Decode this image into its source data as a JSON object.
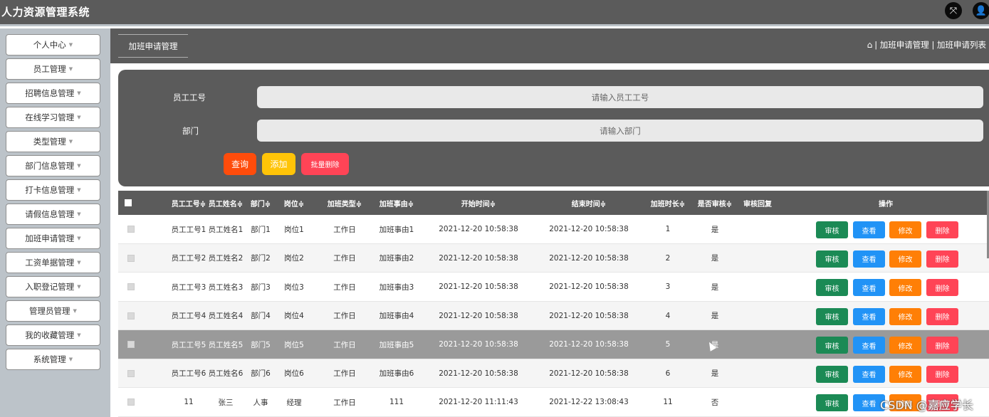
{
  "app": {
    "title": "人力资源管理系统",
    "icons": [
      "fullscreen-icon",
      "user-icon"
    ]
  },
  "sidebar": {
    "items": [
      {
        "label": "个人中心"
      },
      {
        "label": "员工管理"
      },
      {
        "label": "招聘信息管理"
      },
      {
        "label": "在线学习管理"
      },
      {
        "label": "类型管理"
      },
      {
        "label": "部门信息管理"
      },
      {
        "label": "打卡信息管理"
      },
      {
        "label": "请假信息管理"
      },
      {
        "label": "加班申请管理"
      },
      {
        "label": "工资单据管理"
      },
      {
        "label": "入职登记管理"
      },
      {
        "label": "管理员管理"
      },
      {
        "label": "我的收藏管理"
      },
      {
        "label": "系统管理"
      }
    ]
  },
  "header": {
    "tab": "加班申请管理",
    "breadcrumb": "| 加班申请管理 | 加班申请列表"
  },
  "search": {
    "employee_no_label": "员工工号",
    "employee_no_placeholder": "请输入员工工号",
    "dept_label": "部门",
    "dept_placeholder": "请输入部门",
    "query_button": "查询",
    "add_button": "添加",
    "batch_delete_button": "批量删除"
  },
  "table": {
    "columns": [
      "员工工号≑",
      "员工姓名≑",
      "部门≑",
      "岗位≑",
      "加班类型≑",
      "加班事由≑",
      "开始时间≑",
      "结束时间≑",
      "加班时长≑",
      "是否审核≑",
      "审核回复",
      "操作"
    ],
    "rows": [
      {
        "emp_no": "员工工号1",
        "name": "员工姓名1",
        "dept": "部门1",
        "post": "岗位1",
        "type": "工作日",
        "reason": "加班事由1",
        "start": "2021-12-20 10:58:38",
        "end": "2021-12-20 10:58:38",
        "hours": "1",
        "approved": "是",
        "reply": ""
      },
      {
        "emp_no": "员工工号2",
        "name": "员工姓名2",
        "dept": "部门2",
        "post": "岗位2",
        "type": "工作日",
        "reason": "加班事由2",
        "start": "2021-12-20 10:58:38",
        "end": "2021-12-20 10:58:38",
        "hours": "2",
        "approved": "是",
        "reply": ""
      },
      {
        "emp_no": "员工工号3",
        "name": "员工姓名3",
        "dept": "部门3",
        "post": "岗位3",
        "type": "工作日",
        "reason": "加班事由3",
        "start": "2021-12-20 10:58:38",
        "end": "2021-12-20 10:58:38",
        "hours": "3",
        "approved": "是",
        "reply": ""
      },
      {
        "emp_no": "员工工号4",
        "name": "员工姓名4",
        "dept": "部门4",
        "post": "岗位4",
        "type": "工作日",
        "reason": "加班事由4",
        "start": "2021-12-20 10:58:38",
        "end": "2021-12-20 10:58:38",
        "hours": "4",
        "approved": "是",
        "reply": ""
      },
      {
        "emp_no": "员工工号5",
        "name": "员工姓名5",
        "dept": "部门5",
        "post": "岗位5",
        "type": "工作日",
        "reason": "加班事由5",
        "start": "2021-12-20 10:58:38",
        "end": "2021-12-20 10:58:38",
        "hours": "5",
        "approved": "是",
        "reply": ""
      },
      {
        "emp_no": "员工工号6",
        "name": "员工姓名6",
        "dept": "部门6",
        "post": "岗位6",
        "type": "工作日",
        "reason": "加班事由6",
        "start": "2021-12-20 10:58:38",
        "end": "2021-12-20 10:58:38",
        "hours": "6",
        "approved": "是",
        "reply": ""
      },
      {
        "emp_no": "11",
        "name": "张三",
        "dept": "人事",
        "post": "经理",
        "type": "工作日",
        "reason": "111",
        "start": "2021-12-20 11:11:43",
        "end": "2021-12-22 13:08:43",
        "hours": "11",
        "approved": "否",
        "reply": ""
      }
    ],
    "actions": {
      "audit": "审核",
      "view": "查看",
      "edit": "修改",
      "delete": "删除"
    }
  },
  "watermark": "CSDN @嘉应学长",
  "colors": {
    "header_bg": "#5b5b5b",
    "sidebar_bg": "#bcc3c9",
    "query": "#ff4c0b",
    "add": "#ffc408",
    "danger": "#ff4456",
    "audit": "#1b8a55",
    "view": "#2193f6",
    "edit": "#ff7f06"
  }
}
